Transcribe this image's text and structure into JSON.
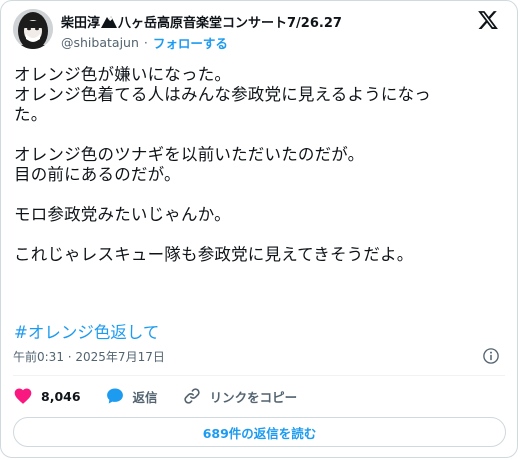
{
  "author": {
    "name": "柴田淳",
    "name_suffix": "八ヶ岳高原音楽堂コンサート7/26.27",
    "handle": "@shibatajun",
    "separator": "·",
    "follow_label": "フォローする",
    "avatar_icon": "avatar-photo",
    "name_icon": "mountain-icon"
  },
  "tweet": {
    "paragraphs": [
      [
        "オレンジ色が嫌いになった。",
        "オレンジ色着てる人はみんな参政党に見えるようになっ",
        "た。"
      ],
      [
        "オレンジ色のツナギを以前いただいたのだが。",
        "目の前にあるのだが。"
      ],
      [
        "モロ参政党みたいじゃんか。"
      ],
      [
        "これじゃレスキュー隊も参政党に見えてきそうだよ。"
      ]
    ],
    "hashtag": "#オレンジ色返して",
    "timestamp": "午前0:31 · 2025年7月17日"
  },
  "actions": {
    "like_count": "8,046",
    "reply_label": "返信",
    "copy_link_label": "リンクをコピー",
    "read_replies_label": "689件の返信を読む"
  },
  "colors": {
    "accent": "#1d9bf0",
    "like": "#f91880",
    "text": "#0f1419",
    "muted": "#536471",
    "border": "#cfd9de"
  }
}
